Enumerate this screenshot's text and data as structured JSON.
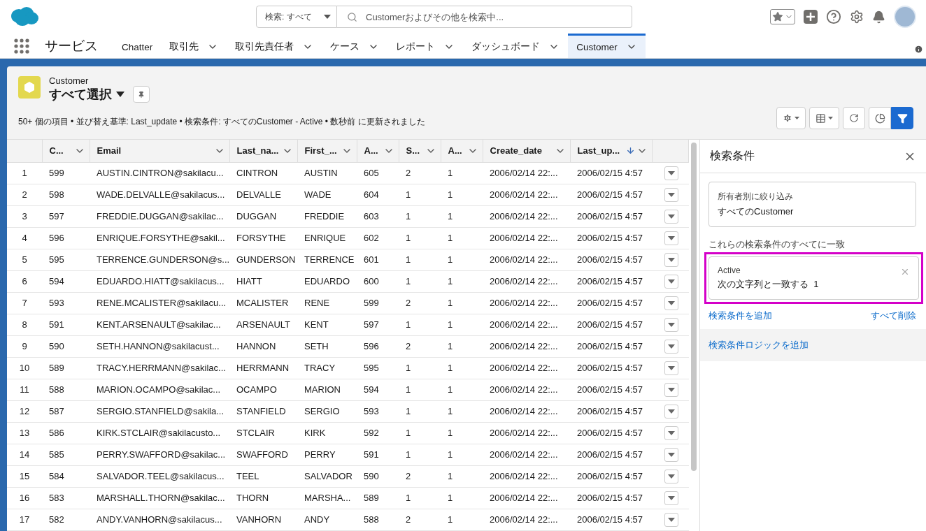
{
  "header": {
    "search_scope": "検索: すべて",
    "search": {
      "placeholder": "Customerおよびその他を検索中..."
    }
  },
  "nav": {
    "app_name": "サービス",
    "tabs": [
      {
        "label": "Chatter",
        "menu": false,
        "selected": false
      },
      {
        "label": "取引先",
        "menu": true,
        "selected": false
      },
      {
        "label": "取引先責任者",
        "menu": true,
        "selected": false
      },
      {
        "label": "ケース",
        "menu": true,
        "selected": false
      },
      {
        "label": "レポート",
        "menu": true,
        "selected": false
      },
      {
        "label": "ダッシュボード",
        "menu": true,
        "selected": false
      },
      {
        "label": "Customer",
        "menu": true,
        "selected": true
      }
    ]
  },
  "list_view": {
    "object": "Customer",
    "title": "すべて選択",
    "summary": "50+ 個の項目 • 並び替え基準: Last_update • 検索条件: すべてのCustomer - Active • 数秒前 に更新されました",
    "view_buttons": [
      {
        "kind": "chart",
        "selected": false
      },
      {
        "kind": "filter",
        "selected": true
      }
    ]
  },
  "table": {
    "columns": [
      {},
      {
        "label": "C...",
        "sorted_desc": false
      },
      {
        "label": "Email",
        "sorted_desc": false
      },
      {
        "label": "Last_na...",
        "sorted_desc": false
      },
      {
        "label": "First_...",
        "sorted_desc": false
      },
      {
        "label": "A...",
        "sorted_desc": false
      },
      {
        "label": "S...",
        "sorted_desc": false
      },
      {
        "label": "A...",
        "sorted_desc": false
      },
      {
        "label": "Create_date",
        "sorted_desc": false
      },
      {
        "label": "Last_up...",
        "sorted_desc": true
      }
    ],
    "rows": [
      [
        "1",
        "599",
        "AUSTIN.CINTRON@sakilacu...",
        "CINTRON",
        "AUSTIN",
        "605",
        "2",
        "1",
        "2006/02/14 22:...",
        "2006/02/15 4:57"
      ],
      [
        "2",
        "598",
        "WADE.DELVALLE@sakilacus...",
        "DELVALLE",
        "WADE",
        "604",
        "1",
        "1",
        "2006/02/14 22:...",
        "2006/02/15 4:57"
      ],
      [
        "3",
        "597",
        "FREDDIE.DUGGAN@sakilac...",
        "DUGGAN",
        "FREDDIE",
        "603",
        "1",
        "1",
        "2006/02/14 22:...",
        "2006/02/15 4:57"
      ],
      [
        "4",
        "596",
        "ENRIQUE.FORSYTHE@sakil...",
        "FORSYTHE",
        "ENRIQUE",
        "602",
        "1",
        "1",
        "2006/02/14 22:...",
        "2006/02/15 4:57"
      ],
      [
        "5",
        "595",
        "TERRENCE.GUNDERSON@s...",
        "GUNDERSON",
        "TERRENCE",
        "601",
        "1",
        "1",
        "2006/02/14 22:...",
        "2006/02/15 4:57"
      ],
      [
        "6",
        "594",
        "EDUARDO.HIATT@sakilacus...",
        "HIATT",
        "EDUARDO",
        "600",
        "1",
        "1",
        "2006/02/14 22:...",
        "2006/02/15 4:57"
      ],
      [
        "7",
        "593",
        "RENE.MCALISTER@sakilacu...",
        "MCALISTER",
        "RENE",
        "599",
        "2",
        "1",
        "2006/02/14 22:...",
        "2006/02/15 4:57"
      ],
      [
        "8",
        "591",
        "KENT.ARSENAULT@sakilac...",
        "ARSENAULT",
        "KENT",
        "597",
        "1",
        "1",
        "2006/02/14 22:...",
        "2006/02/15 4:57"
      ],
      [
        "9",
        "590",
        "SETH.HANNON@sakilacust...",
        "HANNON",
        "SETH",
        "596",
        "2",
        "1",
        "2006/02/14 22:...",
        "2006/02/15 4:57"
      ],
      [
        "10",
        "589",
        "TRACY.HERRMANN@sakilac...",
        "HERRMANN",
        "TRACY",
        "595",
        "1",
        "1",
        "2006/02/14 22:...",
        "2006/02/15 4:57"
      ],
      [
        "11",
        "588",
        "MARION.OCAMPO@sakilac...",
        "OCAMPO",
        "MARION",
        "594",
        "1",
        "1",
        "2006/02/14 22:...",
        "2006/02/15 4:57"
      ],
      [
        "12",
        "587",
        "SERGIO.STANFIELD@sakila...",
        "STANFIELD",
        "SERGIO",
        "593",
        "1",
        "1",
        "2006/02/14 22:...",
        "2006/02/15 4:57"
      ],
      [
        "13",
        "586",
        "KIRK.STCLAIR@sakilacusto...",
        "STCLAIR",
        "KIRK",
        "592",
        "1",
        "1",
        "2006/02/14 22:...",
        "2006/02/15 4:57"
      ],
      [
        "14",
        "585",
        "PERRY.SWAFFORD@sakilac...",
        "SWAFFORD",
        "PERRY",
        "591",
        "1",
        "1",
        "2006/02/14 22:...",
        "2006/02/15 4:57"
      ],
      [
        "15",
        "584",
        "SALVADOR.TEEL@sakilacus...",
        "TEEL",
        "SALVADOR",
        "590",
        "2",
        "1",
        "2006/02/14 22:...",
        "2006/02/15 4:57"
      ],
      [
        "16",
        "583",
        "MARSHALL.THORN@sakilac...",
        "THORN",
        "MARSHA...",
        "589",
        "1",
        "1",
        "2006/02/14 22:...",
        "2006/02/15 4:57"
      ],
      [
        "17",
        "582",
        "ANDY.VANHORN@sakilacus...",
        "VANHORN",
        "ANDY",
        "588",
        "2",
        "1",
        "2006/02/14 22:...",
        "2006/02/15 4:57"
      ]
    ]
  },
  "filter_panel": {
    "title": "検索条件",
    "owner_filter": {
      "label": "所有者別に絞り込み",
      "value": "すべてのCustomer"
    },
    "match_label": "これらの検索条件のすべてに一致",
    "filters": [
      {
        "field": "Active",
        "condition": "次の文字列と一致する  1",
        "highlighted": true
      }
    ],
    "add_filter": "検索条件を追加",
    "remove_all": "すべて削除",
    "add_logic": "検索条件ロジックを追加"
  }
}
